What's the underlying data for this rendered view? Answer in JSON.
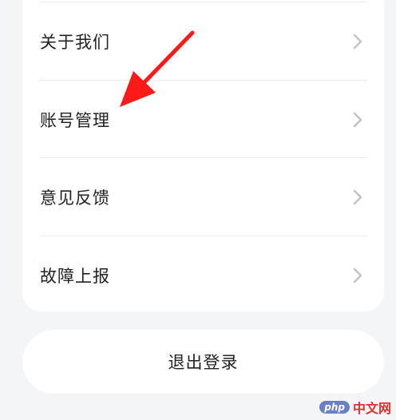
{
  "menu": {
    "items": [
      {
        "label": "关于我们",
        "icon": "chevron-right-icon"
      },
      {
        "label": "账号管理",
        "icon": "chevron-right-icon"
      },
      {
        "label": "意见反馈",
        "icon": "chevron-right-icon"
      },
      {
        "label": "故障上报",
        "icon": "chevron-right-icon"
      }
    ]
  },
  "logout": {
    "label": "退出登录"
  },
  "annotation": {
    "icon": "red-arrow-icon",
    "color": "#ff1a1a"
  },
  "watermark": {
    "badge": "php",
    "text": "中文网"
  },
  "colors": {
    "background": "#f4f5f7",
    "card": "#ffffff",
    "text": "#222222",
    "chevron": "#c4c4c4"
  }
}
